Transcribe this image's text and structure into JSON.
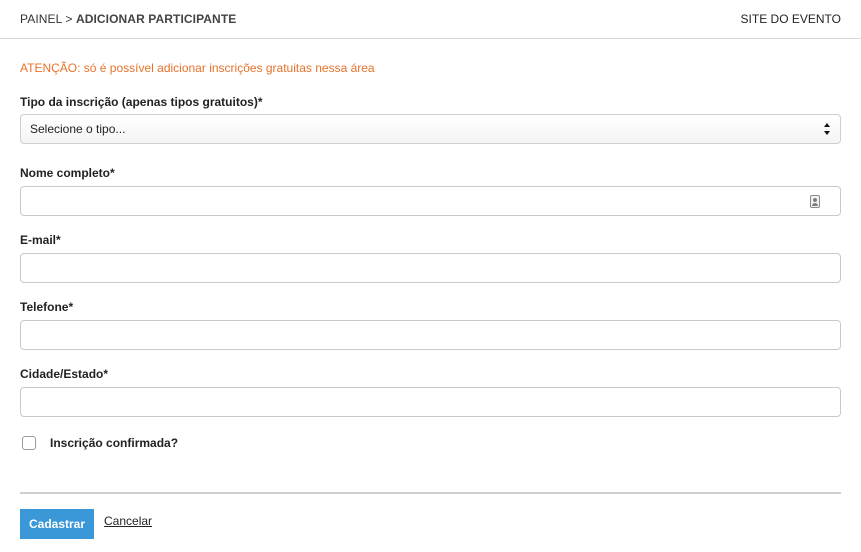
{
  "header": {
    "breadcrumb_root": "PAINEL",
    "breadcrumb_sep": ">",
    "breadcrumb_current": "ADICIONAR PARTICIPANTE",
    "site_link": "SITE DO EVENTO"
  },
  "form": {
    "warning": "ATENÇÃO: só é possível adicionar inscrições gratuitas nessa área",
    "type_label": "Tipo da inscrição (apenas tipos gratuitos)*",
    "type_selected": "Selecione o tipo...",
    "name_label": "Nome completo*",
    "name_value": "",
    "email_label": "E-mail*",
    "email_value": "",
    "phone_label": "Telefone*",
    "phone_value": "",
    "city_label": "Cidade/Estado*",
    "city_value": "",
    "confirmed_label": "Inscrição confirmada?",
    "confirmed": false
  },
  "actions": {
    "submit_label": "Cadastrar",
    "cancel_label": "Cancelar"
  },
  "colors": {
    "warning": "#e8722a",
    "primary_button": "#3a98d8"
  },
  "icons": {
    "type_select": "select-arrows-icon",
    "name_field": "contact-card-icon"
  }
}
